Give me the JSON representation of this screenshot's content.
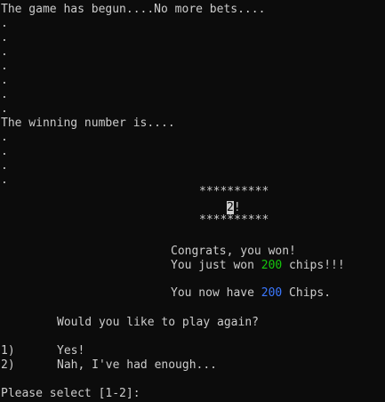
{
  "console": {
    "game_begun": "The game has begun....No more bets....",
    "dot": ".",
    "winning_intro": "The winning number is....",
    "stars": "**********",
    "winning_number": "2",
    "winning_suffix": "!",
    "congrats": "Congrats, you won!",
    "won_prefix": "You just won ",
    "won_amount": "200",
    "won_suffix": " chips!!!",
    "have_prefix": "You now have ",
    "have_amount": "200",
    "have_suffix": " Chips.",
    "play_again_prompt": "Would you like to play again?",
    "options": [
      {
        "number": "1)",
        "label": "Yes!"
      },
      {
        "number": "2)",
        "label": "Nah, I've had enough..."
      }
    ],
    "select_prompt": "Please select [1-2]:"
  },
  "colors": {
    "background": "#0c0c0c",
    "text": "#cccccc",
    "won_amount": "#16c60c",
    "chip_amount": "#3b78ff"
  }
}
